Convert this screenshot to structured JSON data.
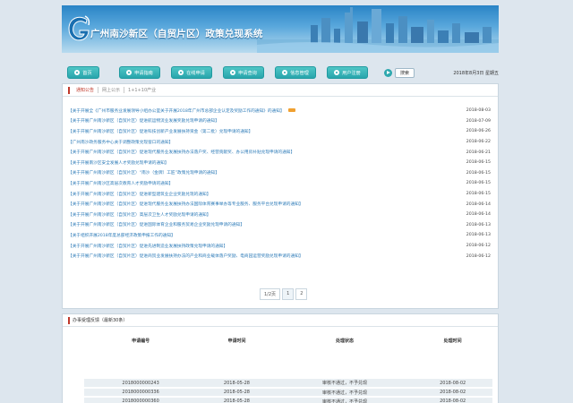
{
  "header": {
    "site_title": "广州南沙新区（自贸片区）政策兑现系统"
  },
  "nav": {
    "items": [
      {
        "label": "首页"
      },
      {
        "label": "申请指南"
      },
      {
        "label": "在线申请"
      },
      {
        "label": "申请查询"
      },
      {
        "label": "信息管理"
      },
      {
        "label": "用户注册"
      }
    ],
    "search_label": "搜索",
    "date_text": "2018年8月3日 星期五"
  },
  "notice": {
    "tabs": [
      "通知公告",
      "网上公示",
      "1+1+10产业"
    ],
    "rows": [
      {
        "title": "【关于开展全《广州市服务业发展领导小组办公室关于开展2018年广州市总部企业认定及奖励工作的通知》的通知】",
        "date": "2018-08-03",
        "new": true
      },
      {
        "title": "【关于开展广州南沙新区（自贸片区）促进航运物流业发展奖励兑现申请的通知】",
        "date": "2018-07-09",
        "new": false
      },
      {
        "title": "【关于开展广州南沙新区（自贸片区）促进科技创新产业发展扶持资金（第二批）兑现申请的通知】",
        "date": "2018-06-26",
        "new": false
      },
      {
        "title": "【广州南沙政务服务中心关于调整政策兑现窗口的通知】",
        "date": "2018-06-22",
        "new": false
      },
      {
        "title": "【关于开展广州南沙新区（自贸片区）促进现代服务业发展扶持办法落户奖、经营贡献奖、办公用房补贴兑现申请的通知】",
        "date": "2018-06-21",
        "new": false
      },
      {
        "title": "【关于开展南沙区安全发展人才奖励兑现申请的通知】",
        "date": "2018-06-15",
        "new": false
      },
      {
        "title": "【关于开展广州南沙新区（自贸片区）“南沙（金牌）工匠”政策兑现申请的通知】",
        "date": "2018-06-15",
        "new": false
      },
      {
        "title": "【关于开展广州南沙区高层次教育人才奖励申请的通知】",
        "date": "2018-06-15",
        "new": false
      },
      {
        "title": "【关于开展广州南沙新区（自贸片区）促进新型建筑业企业奖励兑现的通知】",
        "date": "2018-06-15",
        "new": false
      },
      {
        "title": "【关于开展广州南沙新区（自贸片区）促进现代服务业发展扶持办法国际体育赛事举办等专业服务、服务平台兑现申请的通知】",
        "date": "2018-06-14",
        "new": false
      },
      {
        "title": "【关于开展广州南沙新区（自贸片区）高层次卫生人才奖励兑现申请的通知】",
        "date": "2018-06-14",
        "new": false
      },
      {
        "title": "【关于开展广州南沙新区（自贸片区）促进国际体育企业和服务贸易企业奖励兑现申请的通知】",
        "date": "2018-06-13",
        "new": false
      },
      {
        "title": "【关于组织开展2018年度总部经济政策申报工作的通知】",
        "date": "2018-06-13",
        "new": false
      },
      {
        "title": "【关于开展广州南沙新区（自贸片区）促进先进制造业发展扶持政策兑现申请的通知】",
        "date": "2018-06-12",
        "new": false
      },
      {
        "title": "【关于开展广州南沙新区（自贸片区）促进商贸业发展扶持办法的产业和商业载体落户奖励、电商园运营奖励兑现申请的通知】",
        "date": "2018-06-12",
        "new": false
      }
    ],
    "pager": [
      "1/2页",
      "1",
      "2"
    ]
  },
  "progress": {
    "title": "办事受理反馈（最新30条）",
    "columns": [
      "申请编号",
      "申请时间",
      "处理状态",
      "处理时间"
    ],
    "rows": [
      {
        "id": "2018000000243",
        "apply_time": "2018-05-28",
        "status": "审核不通过，不予兑现",
        "handle_time": "2018-08-02"
      },
      {
        "id": "2018000000336",
        "apply_time": "2018-05-28",
        "status": "审核不通过，不予兑现",
        "handle_time": "2018-08-02"
      },
      {
        "id": "2018000000360",
        "apply_time": "2018-05-28",
        "status": "审核不通过，不予兑现",
        "handle_time": "2018-08-02"
      }
    ]
  }
}
